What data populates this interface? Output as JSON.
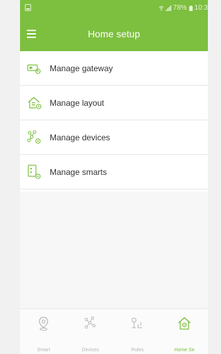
{
  "status_bar": {
    "battery": "78%",
    "time": "10:3"
  },
  "header": {
    "title": "Home setup"
  },
  "menu": {
    "items": [
      {
        "label": "Manage gateway",
        "icon": "gateway-icon"
      },
      {
        "label": "Manage layout",
        "icon": "house-icon"
      },
      {
        "label": "Manage devices",
        "icon": "devices-icon"
      },
      {
        "label": "Manage smarts",
        "icon": "smarts-icon"
      }
    ]
  },
  "tabs": [
    {
      "label": "Smart",
      "icon": "location-pin-icon",
      "active": false
    },
    {
      "label": "Devices",
      "icon": "devices-network-icon",
      "active": false
    },
    {
      "label": "Rules",
      "icon": "rules-icon",
      "active": false
    },
    {
      "label": "Home Se",
      "icon": "home-setup-icon",
      "active": true
    }
  ],
  "colors": {
    "accent": "#7dbf3f",
    "inactive": "#b6b6b6"
  }
}
